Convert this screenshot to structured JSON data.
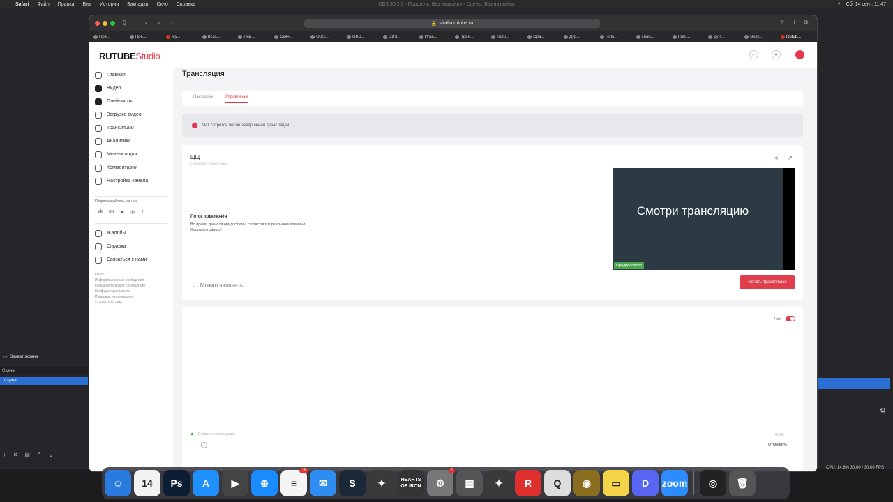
{
  "menubar": {
    "app": "Safari",
    "items": [
      "Файл",
      "Правка",
      "Вид",
      "История",
      "Закладки",
      "Окно",
      "Справка"
    ],
    "obs_title": "OBS 30.2.3 - Профиль: Без названия - Сцены: Без названия",
    "datetime": "Сб, 14 сент. 11:47"
  },
  "browser": {
    "url": "studio.rutube.ru",
    "tabs": [
      "Пре...",
      "Пре...",
      "Му...",
      "Вска...",
      "Пер...",
      "Скач...",
      "OBS...",
      "OBS...",
      "OBS...",
      "Игра...",
      "Тран...",
      "Rutu...",
      "Opa...",
      "Дур...",
      "Rutu...",
      "chan...",
      "Rutu...",
      "ру-т...",
      "Визу...",
      "Rutub..."
    ]
  },
  "studio": {
    "logo_main": "RUTUBE",
    "logo_accent": "Studio",
    "nav": [
      {
        "label": "Главная",
        "icon": "home-icon"
      },
      {
        "label": "Видео",
        "icon": "video-icon"
      },
      {
        "label": "Плейлисты",
        "icon": "playlist-icon"
      },
      {
        "label": "Загрузка видео",
        "icon": "upload-icon"
      },
      {
        "label": "Трансляции",
        "icon": "broadcast-icon"
      },
      {
        "label": "Аналитика",
        "icon": "analytics-icon"
      },
      {
        "label": "Монетизация",
        "icon": "monetization-icon"
      },
      {
        "label": "Комментарии",
        "icon": "comments-icon"
      },
      {
        "label": "Настройка канала",
        "icon": "settings-icon"
      }
    ],
    "subscribe_label": "Подписывайтесь на нас",
    "socials": [
      "vk",
      "ok",
      "tg",
      "zen",
      "+"
    ],
    "nav2": [
      {
        "label": "Жалобы",
        "icon": "complaint-icon"
      },
      {
        "label": "Справка",
        "icon": "help-icon"
      },
      {
        "label": "Связаться с нами",
        "icon": "contact-icon"
      }
    ],
    "footer_links": [
      "О нас",
      "Информационные сообщения",
      "Пользовательское соглашение",
      "Конфиденциальность",
      "Правовая информация",
      "© 2024, RUTUBE"
    ],
    "page_title": "Трансляция",
    "tabs": [
      "Настройки",
      "Управление"
    ],
    "notice": "Чат сотрётся после завершения трансляции",
    "stream": {
      "title": "ЩЩ",
      "subtitle": "Показать описание",
      "connected": "Поток подключён",
      "desc1": "Во время трансляции доступна статистика в реальном времени",
      "desc2": "Хорошего эфира!",
      "ready": "Можно начинать",
      "preview_text": "Смотри трансляцию",
      "preview_badge": "Предпросмотр",
      "start_button": "Начать трансляцию"
    },
    "chat": {
      "label": "Чат",
      "placeholder": "Оставьте сообщение",
      "counter": "0/200",
      "send": "Отправить"
    }
  },
  "obs": {
    "source": "Захват экрана",
    "scenes_header": "Сцены",
    "scene": "Сцена",
    "stats": "CPU: 14.6%   30.00 / 30.00 FPS"
  },
  "dock": [
    {
      "name": "finder",
      "label": "☺",
      "color": "#2a7be0"
    },
    {
      "name": "calendar",
      "label": "14",
      "color": "#f2f2f2"
    },
    {
      "name": "photoshop",
      "label": "Ps",
      "color": "#0d1d33"
    },
    {
      "name": "appstore",
      "label": "A",
      "color": "#1e90ff"
    },
    {
      "name": "finalcut",
      "label": "▶",
      "color": "#444"
    },
    {
      "name": "safari",
      "label": "⊕",
      "color": "#1a8cff"
    },
    {
      "name": "reminders",
      "label": "≡",
      "color": "#f5f5f5",
      "badge": "28"
    },
    {
      "name": "mail",
      "label": "✉",
      "color": "#2f8cf0"
    },
    {
      "name": "steam",
      "label": "S",
      "color": "#1b2838"
    },
    {
      "name": "game1",
      "label": "✦",
      "color": "#3a3a3a"
    },
    {
      "name": "hearts-of-iron",
      "label": "HEARTS OF IRON",
      "color": "#333"
    },
    {
      "name": "system-settings",
      "label": "⚙",
      "color": "#777",
      "badge": "2"
    },
    {
      "name": "launchpad",
      "label": "▦",
      "color": "#555"
    },
    {
      "name": "game2",
      "label": "✦",
      "color": "#3a3a3a"
    },
    {
      "name": "rutube-app",
      "label": "R",
      "color": "#e0302e"
    },
    {
      "name": "quicktime",
      "label": "Q",
      "color": "#ddd"
    },
    {
      "name": "game3",
      "label": "◉",
      "color": "#8a6d1e"
    },
    {
      "name": "notes",
      "label": "▭",
      "color": "#f5d44a"
    },
    {
      "name": "discord",
      "label": "D",
      "color": "#5865f2"
    },
    {
      "name": "zoom",
      "label": "zoom",
      "color": "#2d8cff"
    },
    {
      "name": "obs",
      "label": "◎",
      "color": "#222"
    },
    {
      "name": "trash",
      "label": "🗑",
      "color": "#555"
    }
  ]
}
